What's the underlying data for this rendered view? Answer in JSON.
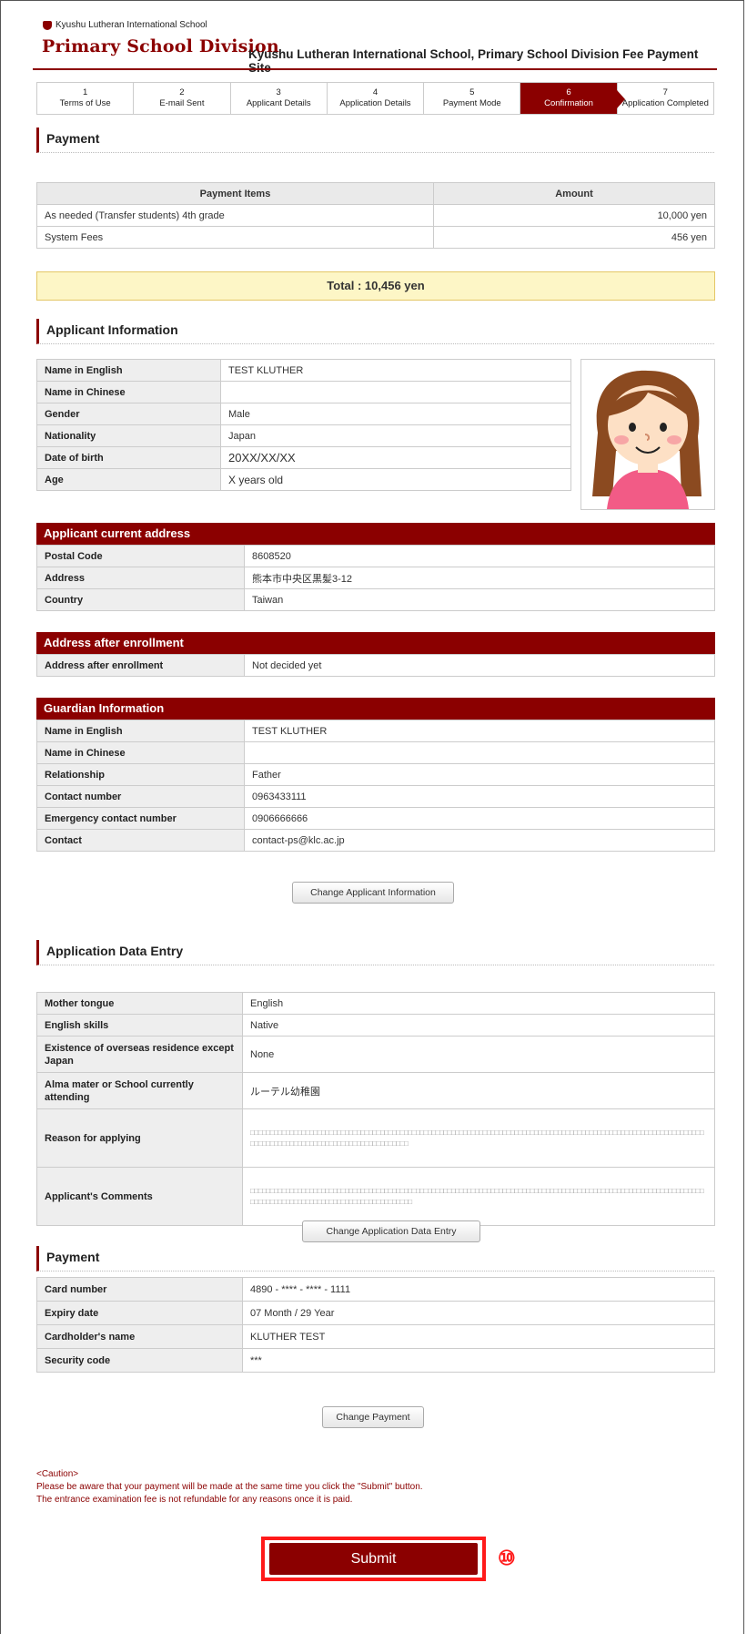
{
  "header": {
    "school_name": "Kyushu Lutheran International School",
    "division": "Primary School Division",
    "site_title": "Kyushu Lutheran International School, Primary School Division Fee Payment Site"
  },
  "steps": [
    {
      "num": "1",
      "label": "Terms of Use"
    },
    {
      "num": "2",
      "label": "E-mail Sent"
    },
    {
      "num": "3",
      "label": "Applicant Details"
    },
    {
      "num": "4",
      "label": "Application Details"
    },
    {
      "num": "5",
      "label": "Payment Mode"
    },
    {
      "num": "6",
      "label": "Confirmation"
    },
    {
      "num": "7",
      "label": "Application Completed"
    }
  ],
  "payment": {
    "heading": "Payment",
    "col_items": "Payment Items",
    "col_amount": "Amount",
    "rows": [
      {
        "item": "As needed (Transfer students) 4th grade",
        "amount": "10,000 yen"
      },
      {
        "item": "System Fees",
        "amount": "456 yen"
      }
    ],
    "total": "Total : 10,456 yen"
  },
  "applicant": {
    "heading": "Applicant Information",
    "rows": [
      {
        "label": "Name in English",
        "value": "TEST KLUTHER"
      },
      {
        "label": "Name in Chinese",
        "value": ""
      },
      {
        "label": "Gender",
        "value": "Male"
      },
      {
        "label": "Nationality",
        "value": "Japan"
      },
      {
        "label": "Date of birth",
        "value": "20XX/XX/XX"
      },
      {
        "label": "Age",
        "value": "X years old"
      }
    ]
  },
  "current_address": {
    "heading": "Applicant current address",
    "rows": [
      {
        "label": "Postal Code",
        "value": "8608520"
      },
      {
        "label": "Address",
        "value": "熊本市中央区黒髪3-12"
      },
      {
        "label": "Country",
        "value": "Taiwan"
      }
    ]
  },
  "address_after": {
    "heading": "Address after enrollment",
    "rows": [
      {
        "label": "Address after enrollment",
        "value": "Not decided yet"
      }
    ]
  },
  "guardian": {
    "heading": "Guardian Information",
    "rows": [
      {
        "label": "Name in English",
        "value": "TEST KLUTHER"
      },
      {
        "label": "Name in Chinese",
        "value": ""
      },
      {
        "label": "Relationship",
        "value": "Father"
      },
      {
        "label": "Contact number",
        "value": "0963433111"
      },
      {
        "label": "Emergency contact number",
        "value": "0906666666"
      },
      {
        "label": "Contact",
        "value": "contact-ps@klc.ac.jp"
      }
    ]
  },
  "change_applicant_btn": "Change Applicant Information",
  "entry": {
    "heading": "Application Data Entry",
    "rows": [
      {
        "label": "Mother tongue",
        "value": "English"
      },
      {
        "label": "English skills",
        "value": "Native"
      },
      {
        "label": "Existence of overseas residence except Japan",
        "value": "None"
      },
      {
        "label": "Alma mater or School currently attending",
        "value": "ルーテル幼稚園"
      },
      {
        "label": "Reason for applying",
        "value": "□□□□□□□□□□□□□□□□□□□□□□□□□□□□□□□□□□□□□□□□□□□□□□□□□□□□□□□□□□□□□□□□□□□□□□□□□□□□□□□□□□□□□□□□□□□□□□□□□□□□□□□□□□□□□□□□□□□□□□□□□□□□□□□□□□□□□□□□□□□□□□□□□□□□□□□□□□□"
      },
      {
        "label": "Applicant's Comments",
        "value": "□□□□□□□□□□□□□□□□□□□□□□□□□□□□□□□□□□□□□□□□□□□□□□□□□□□□□□□□□□□□□□□□□□□□□□□□□□□□□□□□□□□□□□□□□□□□□□□□□□□□□□□□□□□□□□□□□□□□□□□□□□□□□□□□□□□□□□□□□□□□□□□□□□□□□□□□□□□□"
      }
    ]
  },
  "change_entry_btn": "Change Application Data Entry",
  "card": {
    "heading": "Payment",
    "rows": [
      {
        "label": "Card number",
        "value": "4890 - **** - **** - 1111"
      },
      {
        "label": "Expiry date",
        "value": "07 Month / 29 Year"
      },
      {
        "label": "Cardholder's name",
        "value": "KLUTHER TEST"
      },
      {
        "label": "Security code",
        "value": "***"
      }
    ]
  },
  "change_payment_btn": "Change Payment",
  "caution": {
    "title": "<Caution>",
    "line1": "Please be aware that your payment will be made at the same time you click the \"Submit\" button.",
    "line2": "The entrance examination fee is not refundable for any reasons once it is paid."
  },
  "submit_label": "Submit",
  "annotation_badge": "⑩",
  "colors": {
    "brand": "#8b0000",
    "highlight": "#ff1a1a",
    "total_bg": "#fdf6c6"
  }
}
